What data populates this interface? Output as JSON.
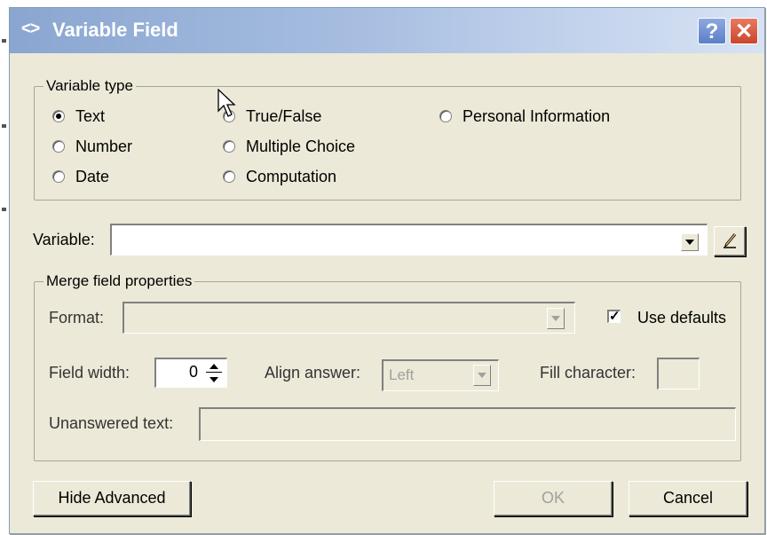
{
  "window": {
    "title": "Variable Field",
    "title_icon": "<>",
    "help_symbol": "?",
    "close_symbol": "✕"
  },
  "variable_type": {
    "legend": "Variable type",
    "options": [
      {
        "label": "Text",
        "checked": true
      },
      {
        "label": "Number",
        "checked": false
      },
      {
        "label": "Date",
        "checked": false
      },
      {
        "label": "True/False",
        "checked": false
      },
      {
        "label": "Multiple Choice",
        "checked": false
      },
      {
        "label": "Computation",
        "checked": false
      },
      {
        "label": "Personal Information",
        "checked": false
      }
    ]
  },
  "variable": {
    "label": "Variable:",
    "value": "",
    "edit_icon": "pencil-icon"
  },
  "merge": {
    "legend": "Merge field properties",
    "format_label": "Format:",
    "format_value": "",
    "use_defaults_label": "Use defaults",
    "use_defaults_checked": true,
    "field_width_label": "Field width:",
    "field_width_value": "0",
    "align_label": "Align answer:",
    "align_value": "Left",
    "fill_label": "Fill character:",
    "fill_value": "",
    "unanswered_label": "Unanswered text:",
    "unanswered_value": ""
  },
  "buttons": {
    "hide_advanced": "Hide Advanced",
    "ok": "OK",
    "cancel": "Cancel"
  }
}
